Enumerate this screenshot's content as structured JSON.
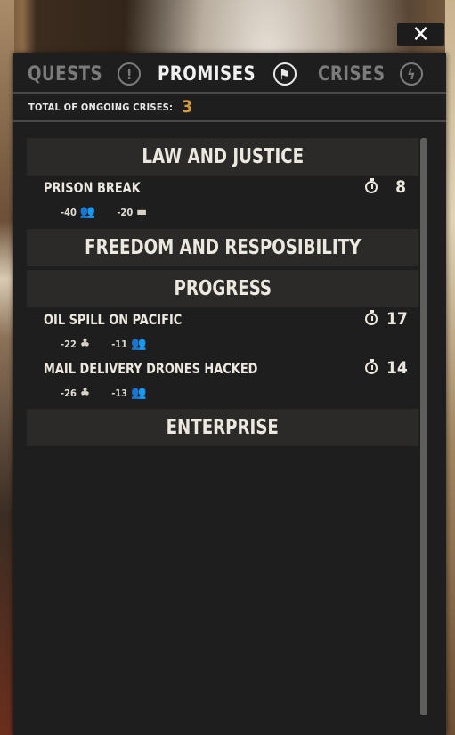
{
  "close": {
    "label": "✕"
  },
  "tabs": [
    {
      "label": "QUESTS",
      "icon": "exclamation-icon",
      "glyph": "!",
      "active": false
    },
    {
      "label": "PROMISES",
      "icon": "flag-icon",
      "glyph": "⚑",
      "active": true
    },
    {
      "label": "CRISES",
      "icon": "lightning-icon",
      "glyph": "ϟ",
      "active": false
    }
  ],
  "summary": {
    "label": "TOTAL OF ONGOING CRISES:",
    "count": "3"
  },
  "categories": [
    {
      "name": "LAW AND JUSTICE"
    },
    {
      "name": "FREEDOM AND RESPOSIBILITY"
    },
    {
      "name": "PROGRESS"
    },
    {
      "name": "ENTERPRISE"
    }
  ],
  "crises": [
    {
      "title": "PRISON BREAK",
      "timer": "8",
      "effects": [
        {
          "value": "-40",
          "icon": "people-icon",
          "glyph": "👥"
        },
        {
          "value": "-20",
          "icon": "tank-icon",
          "glyph": "▬"
        }
      ]
    },
    {
      "title": "OIL SPILL ON PACIFIC",
      "timer": "17",
      "effects": [
        {
          "value": "-22",
          "icon": "ecologist-icon",
          "glyph": "♣"
        },
        {
          "value": "-11",
          "icon": "people-icon",
          "glyph": "👥"
        }
      ]
    },
    {
      "title": "MAIL DELIVERY DRONES HACKED",
      "timer": "14",
      "effects": [
        {
          "value": "-26",
          "icon": "ecologist-icon",
          "glyph": "♣"
        },
        {
          "value": "-13",
          "icon": "people-icon",
          "glyph": "👥"
        }
      ]
    }
  ],
  "colors": {
    "accent": "#d79b3a",
    "panel": "#1e1e1e",
    "category_bg": "#2b2a28"
  }
}
